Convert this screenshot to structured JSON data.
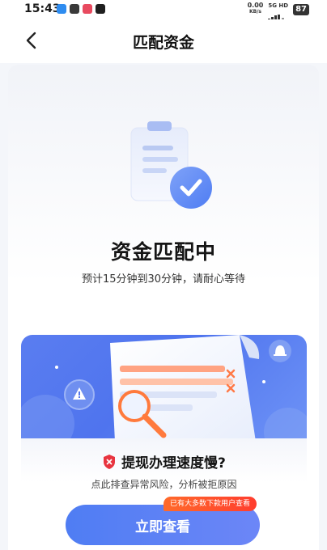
{
  "statusbar": {
    "time": "15:43",
    "net_speed_value": "0.00",
    "net_speed_unit": "KB/s",
    "network_label": "5G HD",
    "battery": "87"
  },
  "header": {
    "title": "匹配资金",
    "back_icon": "chevron-left-icon"
  },
  "status": {
    "title": "资金匹配中",
    "subtitle": "预计15分钟到30分钟，请耐心等待"
  },
  "banner": {
    "warning_title": "提现办理速度慢?",
    "warning_subtitle": "点此排查异常风险，分析被拒原因"
  },
  "cta": {
    "label": "立即查看",
    "badge": "已有大多数下款用户查看"
  },
  "colors": {
    "accent": "#4f7df3",
    "badge": "#ff4a2e",
    "shield": "#e8343f"
  }
}
